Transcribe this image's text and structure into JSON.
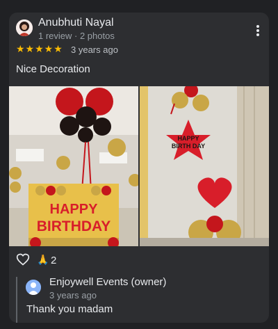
{
  "review": {
    "author": "Anubhuti Nayal",
    "meta": "1 review · 2 photos",
    "stars": "★★★★★",
    "time_ago": "3 years ago",
    "text": "Nice Decoration",
    "reaction_count": "2"
  },
  "owner_reply": {
    "name": "Enjoywell Events (owner)",
    "time_ago": "3 years ago",
    "text": "Thank you madam"
  },
  "photos": {
    "photo1_banner": "HAPPY BIRTHDAY",
    "photo2_star": "HAPPY BIRTH DAY"
  },
  "colors": {
    "background": "#202124",
    "card": "#2d2e31",
    "star": "#fbbc04",
    "owner_avatar": "#8ab4f8"
  }
}
